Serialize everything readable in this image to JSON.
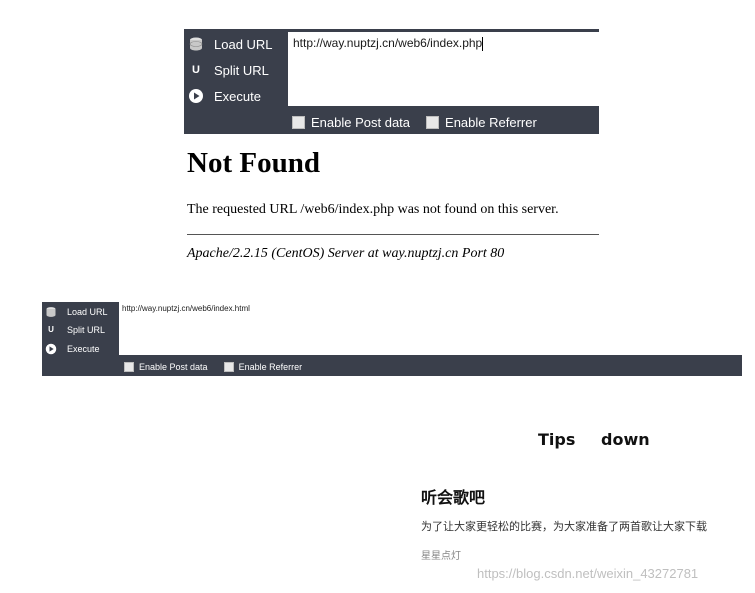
{
  "hackbar_top": {
    "menu": {
      "load_url": "Load URL",
      "split_url": "Split URL",
      "execute": "Execute"
    },
    "url": "http://way.nuptzj.cn/web6/index.php",
    "enable_post": "Enable Post data",
    "enable_referrer": "Enable Referrer"
  },
  "not_found_page": {
    "title": "Not Found",
    "message": "The requested URL /web6/index.php was not found on this server.",
    "address": "Apache/2.2.15 (CentOS) Server at way.nuptzj.cn Port 80"
  },
  "hackbar_bottom": {
    "menu": {
      "load_url": "Load URL",
      "split_url": "Split URL",
      "execute": "Execute"
    },
    "url": "http://way.nuptzj.cn/web6/index.html",
    "enable_post": "Enable Post data",
    "enable_referrer": "Enable Referrer"
  },
  "tips_page": {
    "nav": {
      "tips": "Tips",
      "down": "down"
    },
    "song_title": "听会歌吧",
    "description": "为了让大家更轻松的比赛，为大家准备了两首歌让大家下载",
    "link": "星星点灯"
  },
  "watermark": "https://blog.csdn.net/weixin_43272781",
  "colors": {
    "hackbar_bg": "#3a3f4b",
    "input_bg": "#ffffff",
    "watermark": "#bfbfbf"
  },
  "icons": {
    "load_url": "database-icon",
    "split_url": "magnet-icon",
    "execute": "play-icon"
  }
}
